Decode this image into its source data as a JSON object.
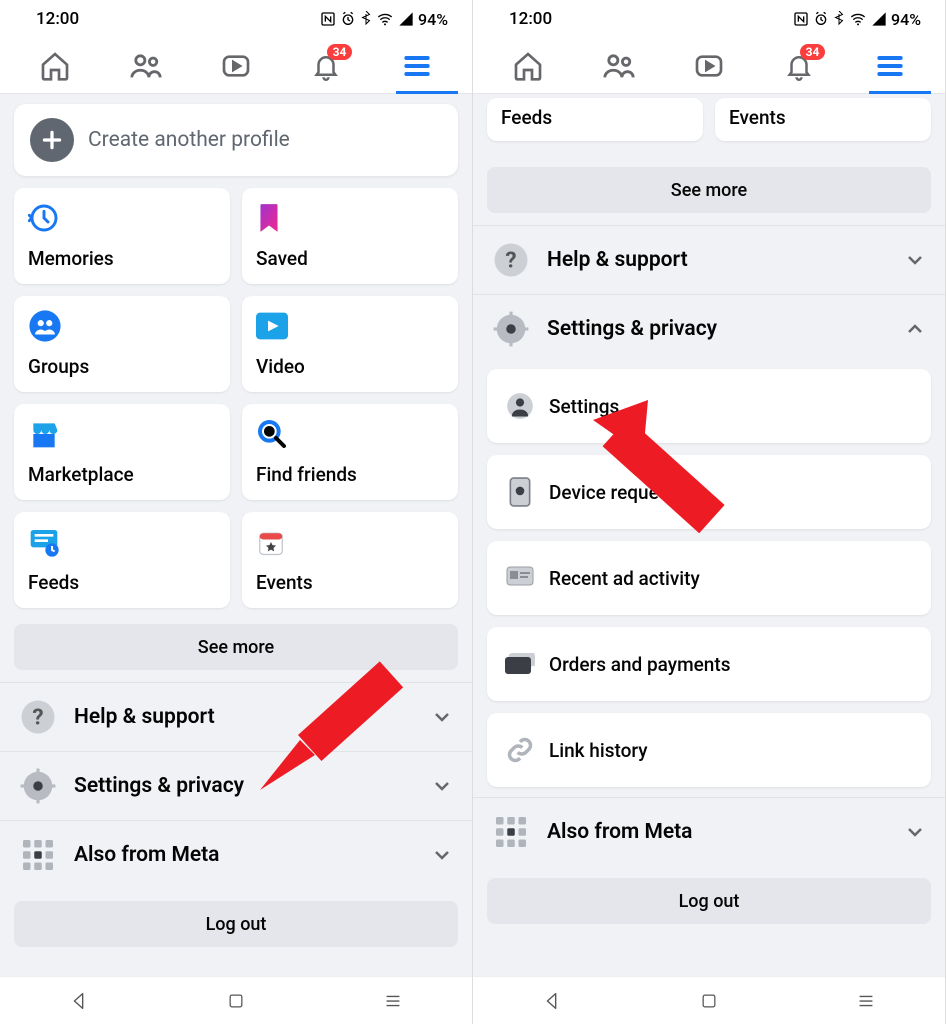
{
  "status": {
    "time": "12:00",
    "battery": "94%"
  },
  "badge": "34",
  "left": {
    "create_label": "Create another profile",
    "shortcuts": [
      {
        "id": "memories",
        "label": "Memories"
      },
      {
        "id": "saved",
        "label": "Saved"
      },
      {
        "id": "groups",
        "label": "Groups"
      },
      {
        "id": "video",
        "label": "Video"
      },
      {
        "id": "marketplace",
        "label": "Marketplace"
      },
      {
        "id": "find-friends",
        "label": "Find friends"
      },
      {
        "id": "feeds",
        "label": "Feeds"
      },
      {
        "id": "events",
        "label": "Events"
      }
    ],
    "see_more": "See more",
    "rows": {
      "help": "Help & support",
      "settings": "Settings & privacy",
      "meta": "Also from Meta"
    },
    "logout": "Log out"
  },
  "right": {
    "mini": {
      "feeds": "Feeds",
      "events": "Events"
    },
    "see_more": "See more",
    "rows": {
      "help": "Help & support",
      "settings": "Settings & privacy",
      "meta": "Also from Meta"
    },
    "subitems": {
      "settings": "Settings",
      "device": "Device requests",
      "adact": "Recent ad activity",
      "orders": "Orders and payments",
      "link": "Link history"
    },
    "logout": "Log out"
  }
}
